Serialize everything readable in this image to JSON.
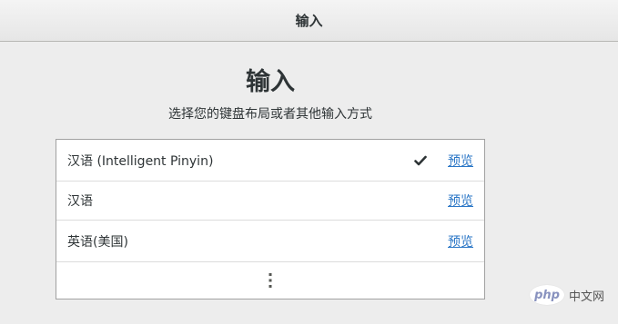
{
  "header": {
    "title": "输入"
  },
  "main": {
    "title": "输入",
    "subtitle": "选择您的键盘布局或者其他输入方式"
  },
  "input_sources": [
    {
      "label": "汉语 (Intelligent Pinyin)",
      "selected": true,
      "preview_label": "预览"
    },
    {
      "label": "汉语",
      "selected": false,
      "preview_label": "预览"
    },
    {
      "label": "英语(美国)",
      "selected": false,
      "preview_label": "预览"
    }
  ],
  "more_icon": "vertical-ellipsis-icon",
  "check_icon": "checkmark-icon",
  "colors": {
    "accent_link": "#2a76c6",
    "background": "#ededed"
  },
  "watermark": {
    "logo_text": "php",
    "text": "中文网"
  }
}
